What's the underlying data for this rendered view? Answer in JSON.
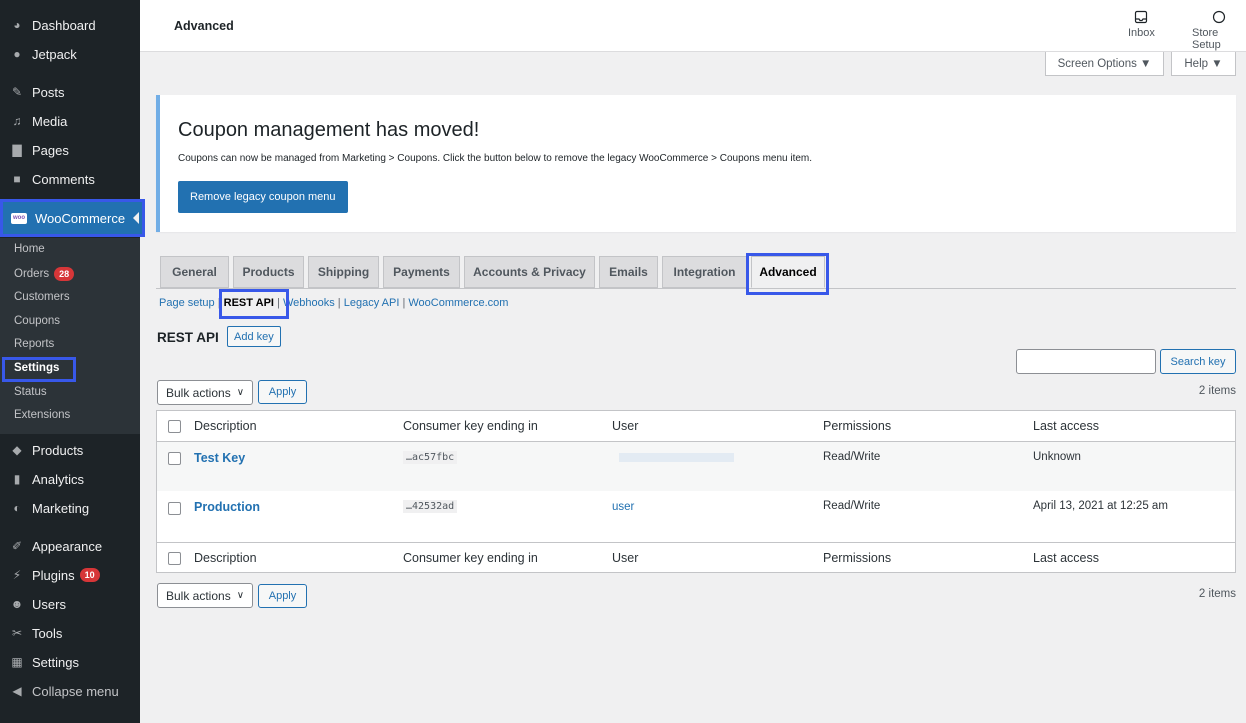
{
  "sidebar": {
    "top_items": [
      {
        "label": "Dashboard",
        "icon": "dashboard-icon"
      },
      {
        "label": "Jetpack",
        "icon": "jetpack-icon"
      },
      {
        "label": "Posts",
        "icon": "pin-icon"
      },
      {
        "label": "Media",
        "icon": "media-icon"
      },
      {
        "label": "Pages",
        "icon": "pages-icon"
      },
      {
        "label": "Comments",
        "icon": "comments-icon"
      }
    ],
    "woocommerce": {
      "label": "WooCommerce",
      "logo_text": "woo"
    },
    "submenu": [
      {
        "label": "Home"
      },
      {
        "label": "Orders",
        "badge": "28"
      },
      {
        "label": "Customers"
      },
      {
        "label": "Coupons"
      },
      {
        "label": "Reports"
      },
      {
        "label": "Settings",
        "current": true
      },
      {
        "label": "Status"
      },
      {
        "label": "Extensions"
      }
    ],
    "bottom_items": [
      {
        "label": "Products",
        "icon": "products-icon"
      },
      {
        "label": "Analytics",
        "icon": "analytics-icon"
      },
      {
        "label": "Marketing",
        "icon": "marketing-icon"
      },
      {
        "label": "Appearance",
        "icon": "brush-icon"
      },
      {
        "label": "Plugins",
        "icon": "plugin-icon",
        "badge": "10"
      },
      {
        "label": "Users",
        "icon": "users-icon"
      },
      {
        "label": "Tools",
        "icon": "wrench-icon"
      },
      {
        "label": "Settings",
        "icon": "settings-icon"
      },
      {
        "label": "Collapse menu",
        "icon": "collapse-icon"
      }
    ]
  },
  "topbar": {
    "title": "Advanced",
    "inbox_label": "Inbox",
    "store_setup_label": "Store Setup"
  },
  "screen_options_label": "Screen Options ▼",
  "help_label": "Help ▼",
  "notice": {
    "title": "Coupon management has moved!",
    "text": "Coupons can now be managed from Marketing > Coupons. Click the button below to remove the legacy WooCommerce > Coupons menu item.",
    "button": "Remove legacy coupon menu"
  },
  "tabs": [
    "General",
    "Products",
    "Shipping",
    "Payments",
    "Accounts & Privacy",
    "Emails",
    "Integration",
    "Advanced"
  ],
  "active_tab": "Advanced",
  "sublinks": {
    "page_setup": "Page setup",
    "rest_api": "REST API",
    "webhooks": "Webhooks",
    "legacy_api": "Legacy API",
    "woocommerce_com": "WooCommerce.com",
    "sep": "|"
  },
  "section": {
    "title": "REST API",
    "add_key": "Add key"
  },
  "search": {
    "button": "Search key",
    "placeholder": ""
  },
  "bulk": {
    "label": "Bulk actions",
    "apply": "Apply",
    "count": "2 items"
  },
  "table": {
    "headers": [
      "Description",
      "Consumer key ending in",
      "User",
      "Permissions",
      "Last access"
    ],
    "rows": [
      {
        "description": "Test Key",
        "key": "…ac57fbc",
        "user": "",
        "permissions": "Read/Write",
        "last_access": "Unknown"
      },
      {
        "description": "Production",
        "key": "…42532ad",
        "user": "user",
        "permissions": "Read/Write",
        "last_access": "April 13, 2021 at 12:25 am"
      }
    ]
  },
  "colors": {
    "accent": "#2271b1",
    "highlight": "#3858e9",
    "sidebar": "#1d2327",
    "badge": "#d63638"
  }
}
